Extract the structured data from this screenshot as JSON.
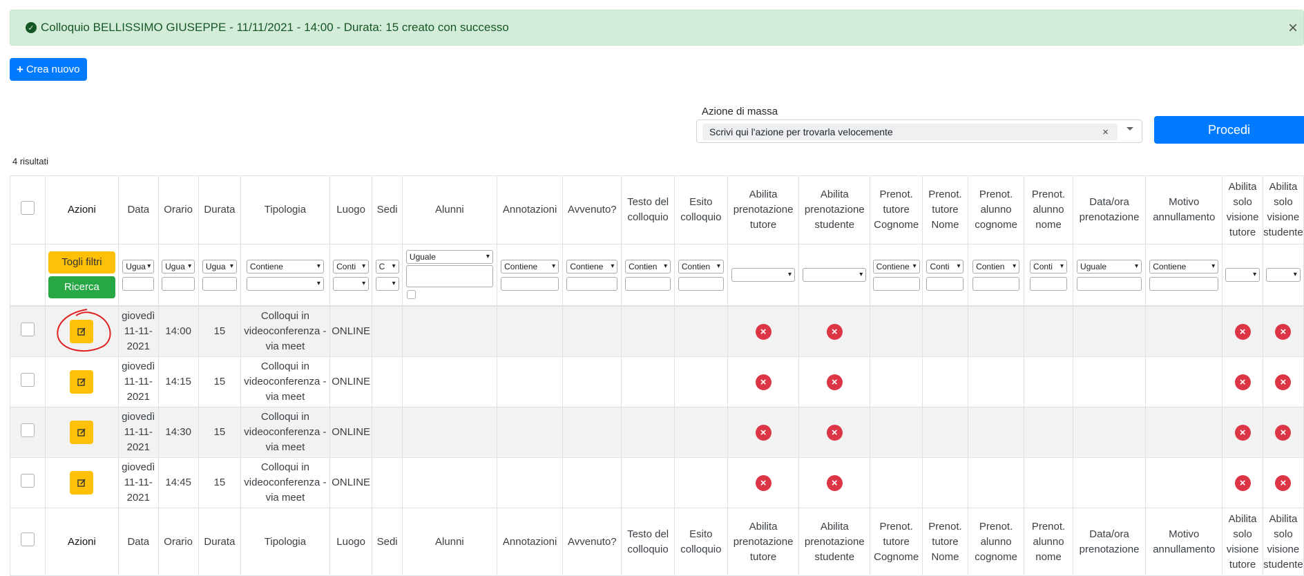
{
  "alert": {
    "icon": "check-circle-icon",
    "message": "Colloquio BELLISSIMO GIUSEPPE - 11/11/2021 - 14:00 - Durata: 15 creato con successo",
    "close": "×"
  },
  "toolbar": {
    "new_label": "Crea nuovo"
  },
  "mass_action": {
    "label": "Azione di massa",
    "placeholder": "Scrivi qui l'azione per trovarla velocemente",
    "clear": "×",
    "proceed_label": "Procedi"
  },
  "results_count": "4 risultati",
  "columns": [
    "Azioni",
    "Data",
    "Orario",
    "Durata",
    "Tipologia",
    "Luogo",
    "Sedi",
    "Alunni",
    "Annotazioni",
    "Avvenuto?",
    "Testo del colloquio",
    "Esito colloquio",
    "Abilita prenotazione tutore",
    "Abilita prenotazione studente",
    "Prenot. tutore Cognome",
    "Prenot. tutore Nome",
    "Prenot. alunno cognome",
    "Prenot. alunno nome",
    "Data/ora prenotazione",
    "Motivo annullamento",
    "Abilita solo visione tutore",
    "Abilita solo visione studente"
  ],
  "filter_buttons": {
    "clear": "Togli filtri",
    "search": "Ricerca"
  },
  "filters": {
    "data": "Ugua",
    "orario": "Ugua",
    "durata": "Ugua",
    "tipologia": "Contiene",
    "luogo": "Conti",
    "sedi": "C",
    "alunni": "Uguale",
    "annotazioni": "Contiene",
    "avvenuto": "Contiene",
    "testo": "Contien",
    "esito": "Contien",
    "prenot_tutore_cognome": "Contiene",
    "prenot_tutore_nome": "Conti",
    "prenot_alunno_cognome": "Contien",
    "prenot_alunno_nome": "Conti",
    "data_ora": "Uguale",
    "motivo": "Contiene"
  },
  "rows": [
    {
      "data": "giovedì 11-11-2021",
      "orario": "14:00",
      "durata": "15",
      "tipologia": "Colloqui in videoconferenza - via meet",
      "luogo": "ONLINE"
    },
    {
      "data": "giovedì 11-11-2021",
      "orario": "14:15",
      "durata": "15",
      "tipologia": "Colloqui in videoconferenza - via meet",
      "luogo": "ONLINE"
    },
    {
      "data": "giovedì 11-11-2021",
      "orario": "14:30",
      "durata": "15",
      "tipologia": "Colloqui in videoconferenza - via meet",
      "luogo": "ONLINE"
    },
    {
      "data": "giovedì 11-11-2021",
      "orario": "14:45",
      "durata": "15",
      "tipologia": "Colloqui in videoconferenza - via meet",
      "luogo": "ONLINE"
    }
  ],
  "colors": {
    "primary": "#007bff",
    "success_bg": "#d4edda",
    "warning": "#ffc107",
    "danger": "#dc3545",
    "green": "#28a745",
    "annotation": "#e02020"
  }
}
